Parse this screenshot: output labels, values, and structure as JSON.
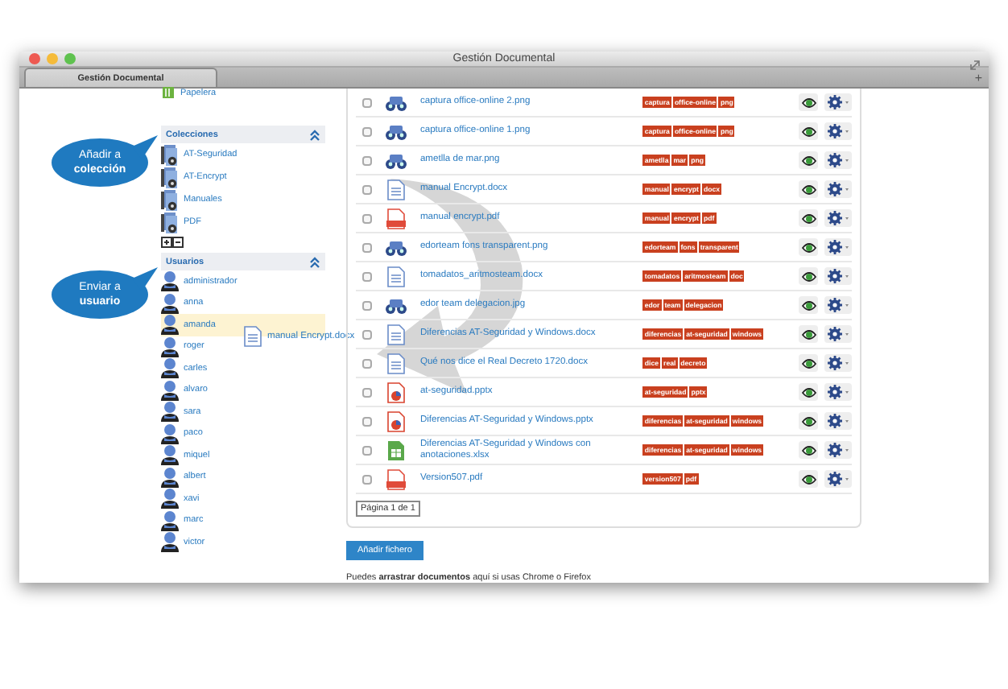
{
  "window": {
    "title": "Gestión Documental"
  },
  "tabs": [
    {
      "label": "Gestión Documental",
      "selected": true
    }
  ],
  "new_tab": "+",
  "sidebar": {
    "trash": {
      "label": "Papelera"
    },
    "collections": {
      "title": "Colecciones",
      "items": [
        {
          "name": "AT-Seguridad"
        },
        {
          "name": "AT-Encrypt"
        },
        {
          "name": "Manuales"
        },
        {
          "name": "PDF"
        }
      ]
    },
    "users": {
      "title": "Usuarios",
      "items": [
        {
          "name": "administrador",
          "selected": false
        },
        {
          "name": "anna",
          "selected": false
        },
        {
          "name": "amanda",
          "selected": true
        },
        {
          "name": "roger",
          "selected": false
        },
        {
          "name": "carles",
          "selected": false
        },
        {
          "name": "alvaro",
          "selected": false
        },
        {
          "name": "sara",
          "selected": false
        },
        {
          "name": "paco",
          "selected": false
        },
        {
          "name": "miquel",
          "selected": false
        },
        {
          "name": "albert",
          "selected": false
        },
        {
          "name": "xavi",
          "selected": false
        },
        {
          "name": "marc",
          "selected": false
        },
        {
          "name": "victor",
          "selected": false
        }
      ]
    }
  },
  "callouts": [
    {
      "lines": [
        "Añadir a",
        "colección"
      ]
    },
    {
      "lines": [
        "Enviar a",
        "usuario"
      ]
    }
  ],
  "drag_ghost": {
    "label": "manual Encrypt.docx"
  },
  "files": [
    {
      "name": "captura office-online 2.png",
      "kind": "image",
      "checked": false,
      "tags": [
        "captura",
        "office-online",
        "png"
      ]
    },
    {
      "name": "captura office-online 1.png",
      "kind": "image",
      "checked": false,
      "tags": [
        "captura",
        "office-online",
        "png"
      ]
    },
    {
      "name": "ametlla de mar.png",
      "kind": "image",
      "checked": false,
      "tags": [
        "ametlla",
        "mar",
        "png"
      ]
    },
    {
      "name": "manual Encrypt.docx",
      "kind": "word",
      "checked": false,
      "tags": [
        "manual",
        "encrypt",
        "docx"
      ]
    },
    {
      "name": "manual encrypt.pdf",
      "kind": "pdf",
      "checked": false,
      "tags": [
        "manual",
        "encrypt",
        "pdf"
      ]
    },
    {
      "name": "edorteam fons transparent.png",
      "kind": "image",
      "checked": false,
      "tags": [
        "edorteam",
        "fons",
        "transparent"
      ]
    },
    {
      "name": "tomadatos_aritmosteam.docx",
      "kind": "word",
      "checked": false,
      "tags": [
        "tomadatos",
        "aritmosteam",
        "doc"
      ]
    },
    {
      "name": "edor team delegacion.jpg",
      "kind": "image",
      "checked": false,
      "tags": [
        "edor",
        "team",
        "delegacion"
      ]
    },
    {
      "name": "Diferencias AT-Seguridad y Windows.docx",
      "kind": "word",
      "checked": false,
      "tags": [
        "diferencias",
        "at-seguridad",
        "windows"
      ]
    },
    {
      "name": "Qué nos dice el Real Decreto 1720.docx",
      "kind": "word",
      "checked": false,
      "tags": [
        "dice",
        "real",
        "decreto"
      ]
    },
    {
      "name": "at-seguridad.pptx",
      "kind": "ppt",
      "checked": false,
      "tags": [
        "at-seguridad",
        "pptx"
      ]
    },
    {
      "name": "Diferencias AT-Seguridad y Windows.pptx",
      "kind": "ppt",
      "checked": false,
      "tags": [
        "diferencias",
        "at-seguridad",
        "windows"
      ]
    },
    {
      "name": "Diferencias AT-Seguridad y Windows con anotaciones.xlsx",
      "kind": "excel",
      "checked": false,
      "tags": [
        "diferencias",
        "at-seguridad",
        "windows"
      ]
    },
    {
      "name": "Version507.pdf",
      "kind": "pdf",
      "checked": false,
      "tags": [
        "version507",
        "pdf"
      ]
    }
  ],
  "pager": "Página 1 de 1",
  "add_button": "Añadir fichero",
  "hint": "Puedes **arrastrar documentos** aquí si usas Chrome o Firefox"
}
